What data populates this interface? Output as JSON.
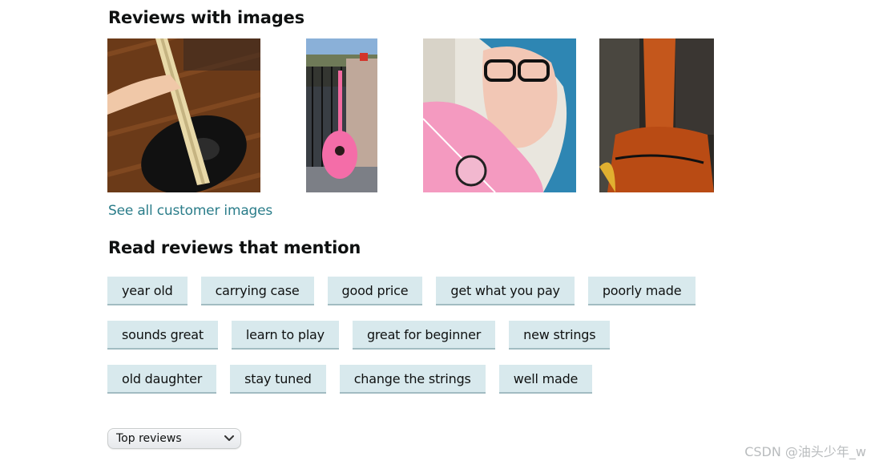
{
  "reviews_with_images": {
    "title": "Reviews with images",
    "images": [
      {
        "name": "customer-image-1",
        "alt": "black acoustic guitar held over wooden floor",
        "tone": "#5a3317"
      },
      {
        "name": "customer-image-2",
        "alt": "pink guitar on balcony",
        "tone": "#b9978a"
      },
      {
        "name": "customer-image-3",
        "alt": "person with blue hair holding pink guitar",
        "tone": "#f4b7c9"
      },
      {
        "name": "customer-image-4",
        "alt": "orange guitar close-up",
        "tone": "#b34a12"
      }
    ],
    "see_all_label": "See all customer images"
  },
  "read_reviews_mention": {
    "title": "Read reviews that mention",
    "rows": [
      [
        "year old",
        "carrying case",
        "good price",
        "get what you pay",
        "poorly made"
      ],
      [
        "sounds great",
        "learn to play",
        "great for beginner",
        "new strings"
      ],
      [
        "old daughter",
        "stay tuned",
        "change the strings",
        "well made"
      ]
    ]
  },
  "sort": {
    "selected": "Top reviews",
    "icon": "chevron-down-icon"
  },
  "watermark": "CSDN @油头少年_w",
  "colors": {
    "chip_bg": "#d8e9ed",
    "chip_border": "#a2bcc2",
    "link": "#2b7d8a"
  }
}
